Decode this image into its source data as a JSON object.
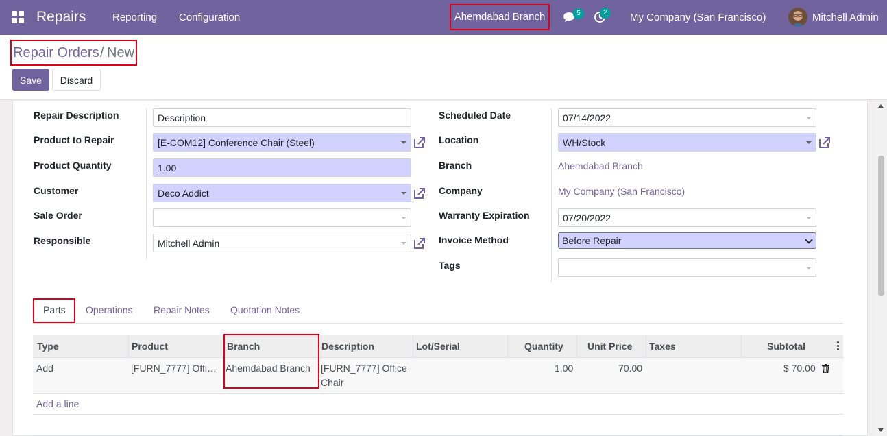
{
  "navbar": {
    "app_name": "Repairs",
    "menu": [
      "Reporting",
      "Configuration"
    ],
    "branch": "Ahemdabad Branch",
    "messages_count": "5",
    "activities_count": "2",
    "company": "My Company (San Francisco)",
    "user": "Mitchell Admin"
  },
  "breadcrumb": {
    "parent": "Repair Orders",
    "separator": "/",
    "current": "New"
  },
  "buttons": {
    "save": "Save",
    "discard": "Discard"
  },
  "form_left": {
    "repair_description": {
      "label": "Repair Description",
      "value": "Description"
    },
    "product_to_repair": {
      "label": "Product to Repair",
      "value": "[E-COM12] Conference Chair (Steel)"
    },
    "product_quantity": {
      "label": "Product Quantity",
      "value": "1.00"
    },
    "customer": {
      "label": "Customer",
      "value": "Deco Addict"
    },
    "sale_order": {
      "label": "Sale Order",
      "value": ""
    },
    "responsible": {
      "label": "Responsible",
      "value": "Mitchell Admin"
    }
  },
  "form_right": {
    "scheduled_date": {
      "label": "Scheduled Date",
      "value": "07/14/2022"
    },
    "location": {
      "label": "Location",
      "value": "WH/Stock"
    },
    "branch": {
      "label": "Branch",
      "value": "Ahemdabad Branch"
    },
    "company": {
      "label": "Company",
      "value": "My Company (San Francisco)"
    },
    "warranty_expiration": {
      "label": "Warranty Expiration",
      "value": "07/20/2022"
    },
    "invoice_method": {
      "label": "Invoice Method",
      "value": "Before Repair"
    },
    "tags": {
      "label": "Tags",
      "value": ""
    }
  },
  "tabs": [
    "Parts",
    "Operations",
    "Repair Notes",
    "Quotation Notes"
  ],
  "table": {
    "columns": [
      "Type",
      "Product",
      "Branch",
      "Description",
      "Lot/Serial",
      "Quantity",
      "Unit Price",
      "Taxes",
      "Subtotal"
    ],
    "rows": [
      {
        "type": "Add",
        "product": "[FURN_7777] Offi…",
        "branch": "Ahemdabad Branch",
        "description_line1": "[FURN_7777] Office",
        "description_line2": "Chair",
        "lot_serial": "",
        "quantity": "1.00",
        "unit_price": "70.00",
        "taxes": "",
        "subtotal": "$ 70.00"
      }
    ],
    "add_line": "Add a line"
  },
  "colors": {
    "brand": "#71639e",
    "required_bg": "#d2d2ff",
    "highlight": "#e0001a",
    "badge": "#00a09d"
  }
}
